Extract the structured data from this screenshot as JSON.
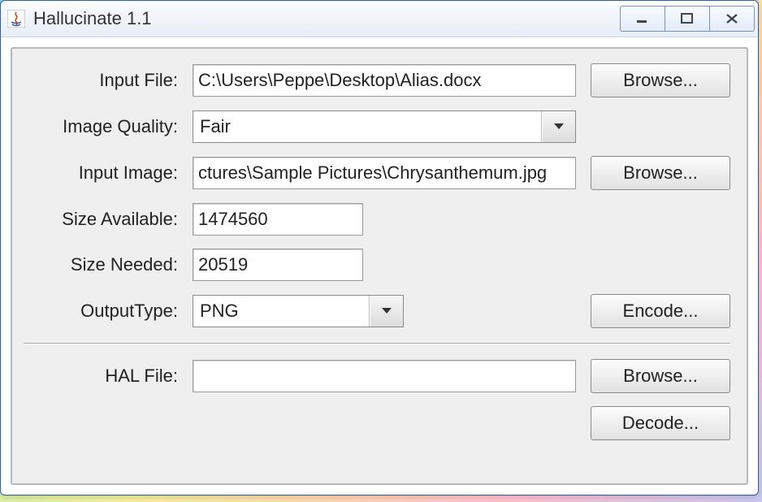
{
  "window": {
    "title": "Hallucinate 1.1"
  },
  "labels": {
    "inputFile": "Input File:",
    "imageQuality": "Image Quality:",
    "inputImage": "Input Image:",
    "sizeAvailable": "Size Available:",
    "sizeNeeded": "Size Needed:",
    "outputType": "OutputType:",
    "halFile": "HAL File:"
  },
  "fields": {
    "inputFile": "C:\\Users\\Peppe\\Desktop\\Alias.docx",
    "imageQuality": "Fair",
    "inputImage": "ctures\\Sample Pictures\\Chrysanthemum.jpg",
    "sizeAvailable": "1474560",
    "sizeNeeded": "20519",
    "outputType": "PNG",
    "halFile": ""
  },
  "buttons": {
    "browse": "Browse...",
    "encode": "Encode...",
    "decode": "Decode..."
  }
}
